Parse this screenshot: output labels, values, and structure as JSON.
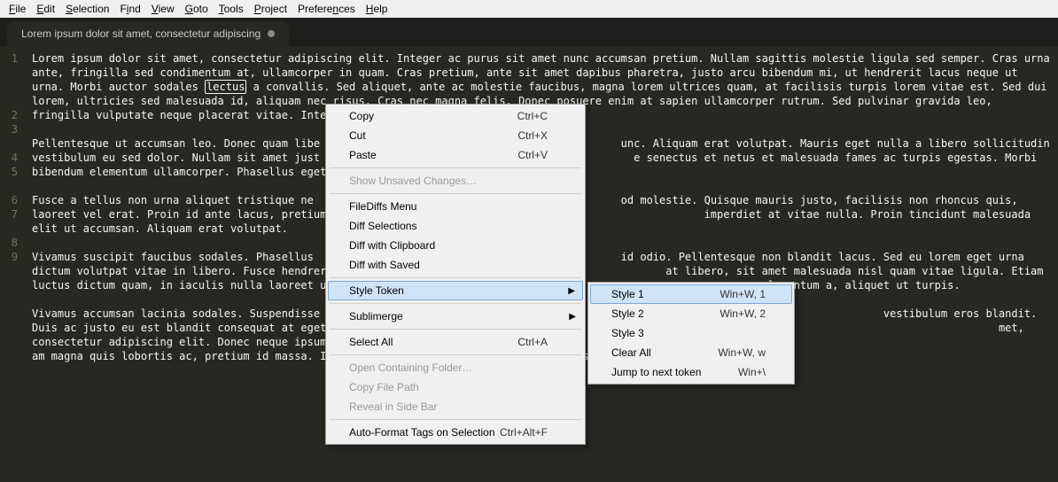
{
  "menubar": [
    "File",
    "Edit",
    "Selection",
    "Find",
    "View",
    "Goto",
    "Tools",
    "Project",
    "Preferences",
    "Help"
  ],
  "tab": {
    "title": "Lorem ipsum dolor sit amet, consectetur adipiscing"
  },
  "gutter": [
    "1",
    "2",
    "3",
    "",
    "4",
    "5",
    "",
    "6",
    "7",
    "",
    "8",
    "9"
  ],
  "code": {
    "l1": "Lorem ipsum dolor sit amet, consectetur adipiscing elit. Integer ac purus sit amet nunc accumsan pretium. Nullam sagittis molestie ligula sed semper. Cras urna ante, fringilla sed condimentum at, ullamcorper in quam. Cras pretium, ante sit amet dapibus pharetra, justo arcu bibendum mi, ut hendrerit lacus neque ut urna. Morbi auctor sodales ",
    "l1b": " a convallis. Sed aliquet, ante ac molestie faucibus, magna lorem ultrices quam, at facilisis turpis lorem vitae est. Sed dui lorem, ultricies sed malesuada id, aliquam nec risus. Cras nec magna felis. Donec posuere enim at sapien ullamcorper rutrum. Sed pulvinar gravida leo, fringilla vulputate neque placerat vitae. Integer et nunc at ",
    "lectus_sel_a": "lectus",
    "lectus_sel_b": "lect",
    "l3": "Pellentesque ut accumsan leo. Donec quam libe",
    "l3b": "unc. Aliquam erat volutpat. Mauris eget nulla a libero sollicitudin vestibulum eu sed dolor. Nullam sit amet just",
    "l3c": "e senectus et netus et malesuada fames ac turpis egestas. Morbi bibendum elementum ullamcorper. Phasellus eget tortor",
    "l5": "Fusce a tellus non urna aliquet tristique ne",
    "l5b": "od molestie. Quisque mauris justo, facilisis non rhoncus quis, laoreet vel erat. Proin id ante lacus, pretium porta nis",
    "l5c": " imperdiet at vitae nulla. Proin tincidunt malesuada elit ut accumsan. Aliquam erat volutpat.",
    "l7": "Vivamus suscipit faucibus sodales. Phasellus",
    "l7b": "id odio. Pellentesque non blandit lacus. Sed eu lorem eget urna dictum volutpat vitae in libero. Fusce hendrerit, a",
    "l7c": "at libero, sit amet malesuada nisl quam vitae ligula. Etiam luctus dictum quam, in iaculis nulla laoreet ut. Aenean id",
    "l7d": "rem nec elementum a, aliquet ut turpis.",
    "l9": "Vivamus accumsan lacinia sodales. Suspendisse",
    "l9b": "vestibulum eros blandit. Duis ac justo eu est blandit consequat at eget felis. Sed vulp",
    "l9c": "met, consectetur adipiscing elit. Donec neque ipsum, laoreet non ultricies sit amet,",
    "l9d": "am magna quis lobortis ac, pretium id massa. In hac habitasse platea dictumst. Nullam sit ame"
  },
  "ctx": {
    "copy": "Copy",
    "copy_k": "Ctrl+C",
    "cut": "Cut",
    "cut_k": "Ctrl+X",
    "paste": "Paste",
    "paste_k": "Ctrl+V",
    "unsaved": "Show Unsaved Changes…",
    "fdmenu": "FileDiffs Menu",
    "diffsel": "Diff Selections",
    "diffclip": "Diff with Clipboard",
    "diffsaved": "Diff with Saved",
    "styletoken": "Style Token",
    "sublimerge": "Sublimerge",
    "selectall": "Select All",
    "selectall_k": "Ctrl+A",
    "openfolder": "Open Containing Folder…",
    "copypath": "Copy File Path",
    "reveal": "Reveal in Side Bar",
    "autofmt": "Auto-Format Tags on Selection",
    "autofmt_k": "Ctrl+Alt+F"
  },
  "sub": {
    "s1": "Style 1",
    "s1k": "Win+W, 1",
    "s2": "Style 2",
    "s2k": "Win+W, 2",
    "s3": "Style 3",
    "clear": "Clear All",
    "cleark": "Win+W, w",
    "jump": "Jump to next token",
    "jumpk": "Win+\\"
  }
}
